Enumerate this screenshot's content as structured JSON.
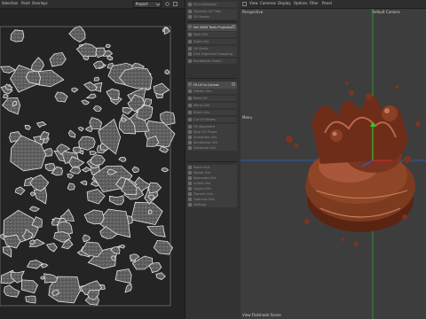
{
  "uv_editor": {
    "menu": [
      "Selection",
      "Paint",
      "Overlays"
    ],
    "view_dropdown": "Project"
  },
  "tool_panel": {
    "items": [
      {
        "label": "Fit to Selection",
        "highlight": false
      },
      {
        "label": "Visualize UV Tiles",
        "highlight": false
      },
      {
        "label": "UV Seams",
        "highlight": false
      },
      {
        "label": "Set UDIM Texts Projection",
        "highlight": true
      },
      {
        "label": "Pack UVs",
        "highlight": false
      },
      {
        "label": "Scale UVs",
        "highlight": false
      },
      {
        "label": "UV Shells",
        "highlight": false
      },
      {
        "label": "Grid Alignment Snapping",
        "highlight": false
      },
      {
        "label": "Randomize Shells",
        "highlight": false
      },
      {
        "label": "Fit UV to Canvas",
        "highlight": true
      },
      {
        "label": "Flatten UVs",
        "highlight": false
      },
      {
        "label": "Relax UV",
        "highlight": false
      },
      {
        "label": "Mirror UVs",
        "highlight": false
      },
      {
        "label": "Stitch UVs",
        "highlight": false
      },
      {
        "label": "Cut UV Seams",
        "highlight": false
      },
      {
        "label": "UV Alignment",
        "highlight": false
      },
      {
        "label": "Align UV Pivots",
        "highlight": false
      },
      {
        "label": "Straighten UVs",
        "highlight": false
      },
      {
        "label": "Randomize UVs",
        "highlight": false
      },
      {
        "label": "Distribute UVs",
        "highlight": false
      },
      {
        "label": "Match UVs",
        "highlight": false
      },
      {
        "label": "Rotate UVs",
        "highlight": false
      },
      {
        "label": "Normalize UVs",
        "highlight": false
      },
      {
        "label": "Unfold UVs",
        "highlight": false
      },
      {
        "label": "Layout UVs",
        "highlight": false
      },
      {
        "label": "Transfer UVs",
        "highlight": false
      },
      {
        "label": "Optimize UVs",
        "highlight": false
      },
      {
        "label": "Settings",
        "highlight": false
      }
    ]
  },
  "viewport": {
    "menu": [
      "View",
      "Cameras",
      "Display",
      "Options",
      "Filter",
      "Panel"
    ],
    "projection_label": "Perspective",
    "camera_label": "Default Camera",
    "filter_label": "Menu",
    "bottom_label": "View Flatshade Scene",
    "colors": {
      "background": "#3d3d3d",
      "grid_axis_x": "#2b60c8",
      "grid_axis_y": "#28b428",
      "model": "#7a3520"
    }
  }
}
